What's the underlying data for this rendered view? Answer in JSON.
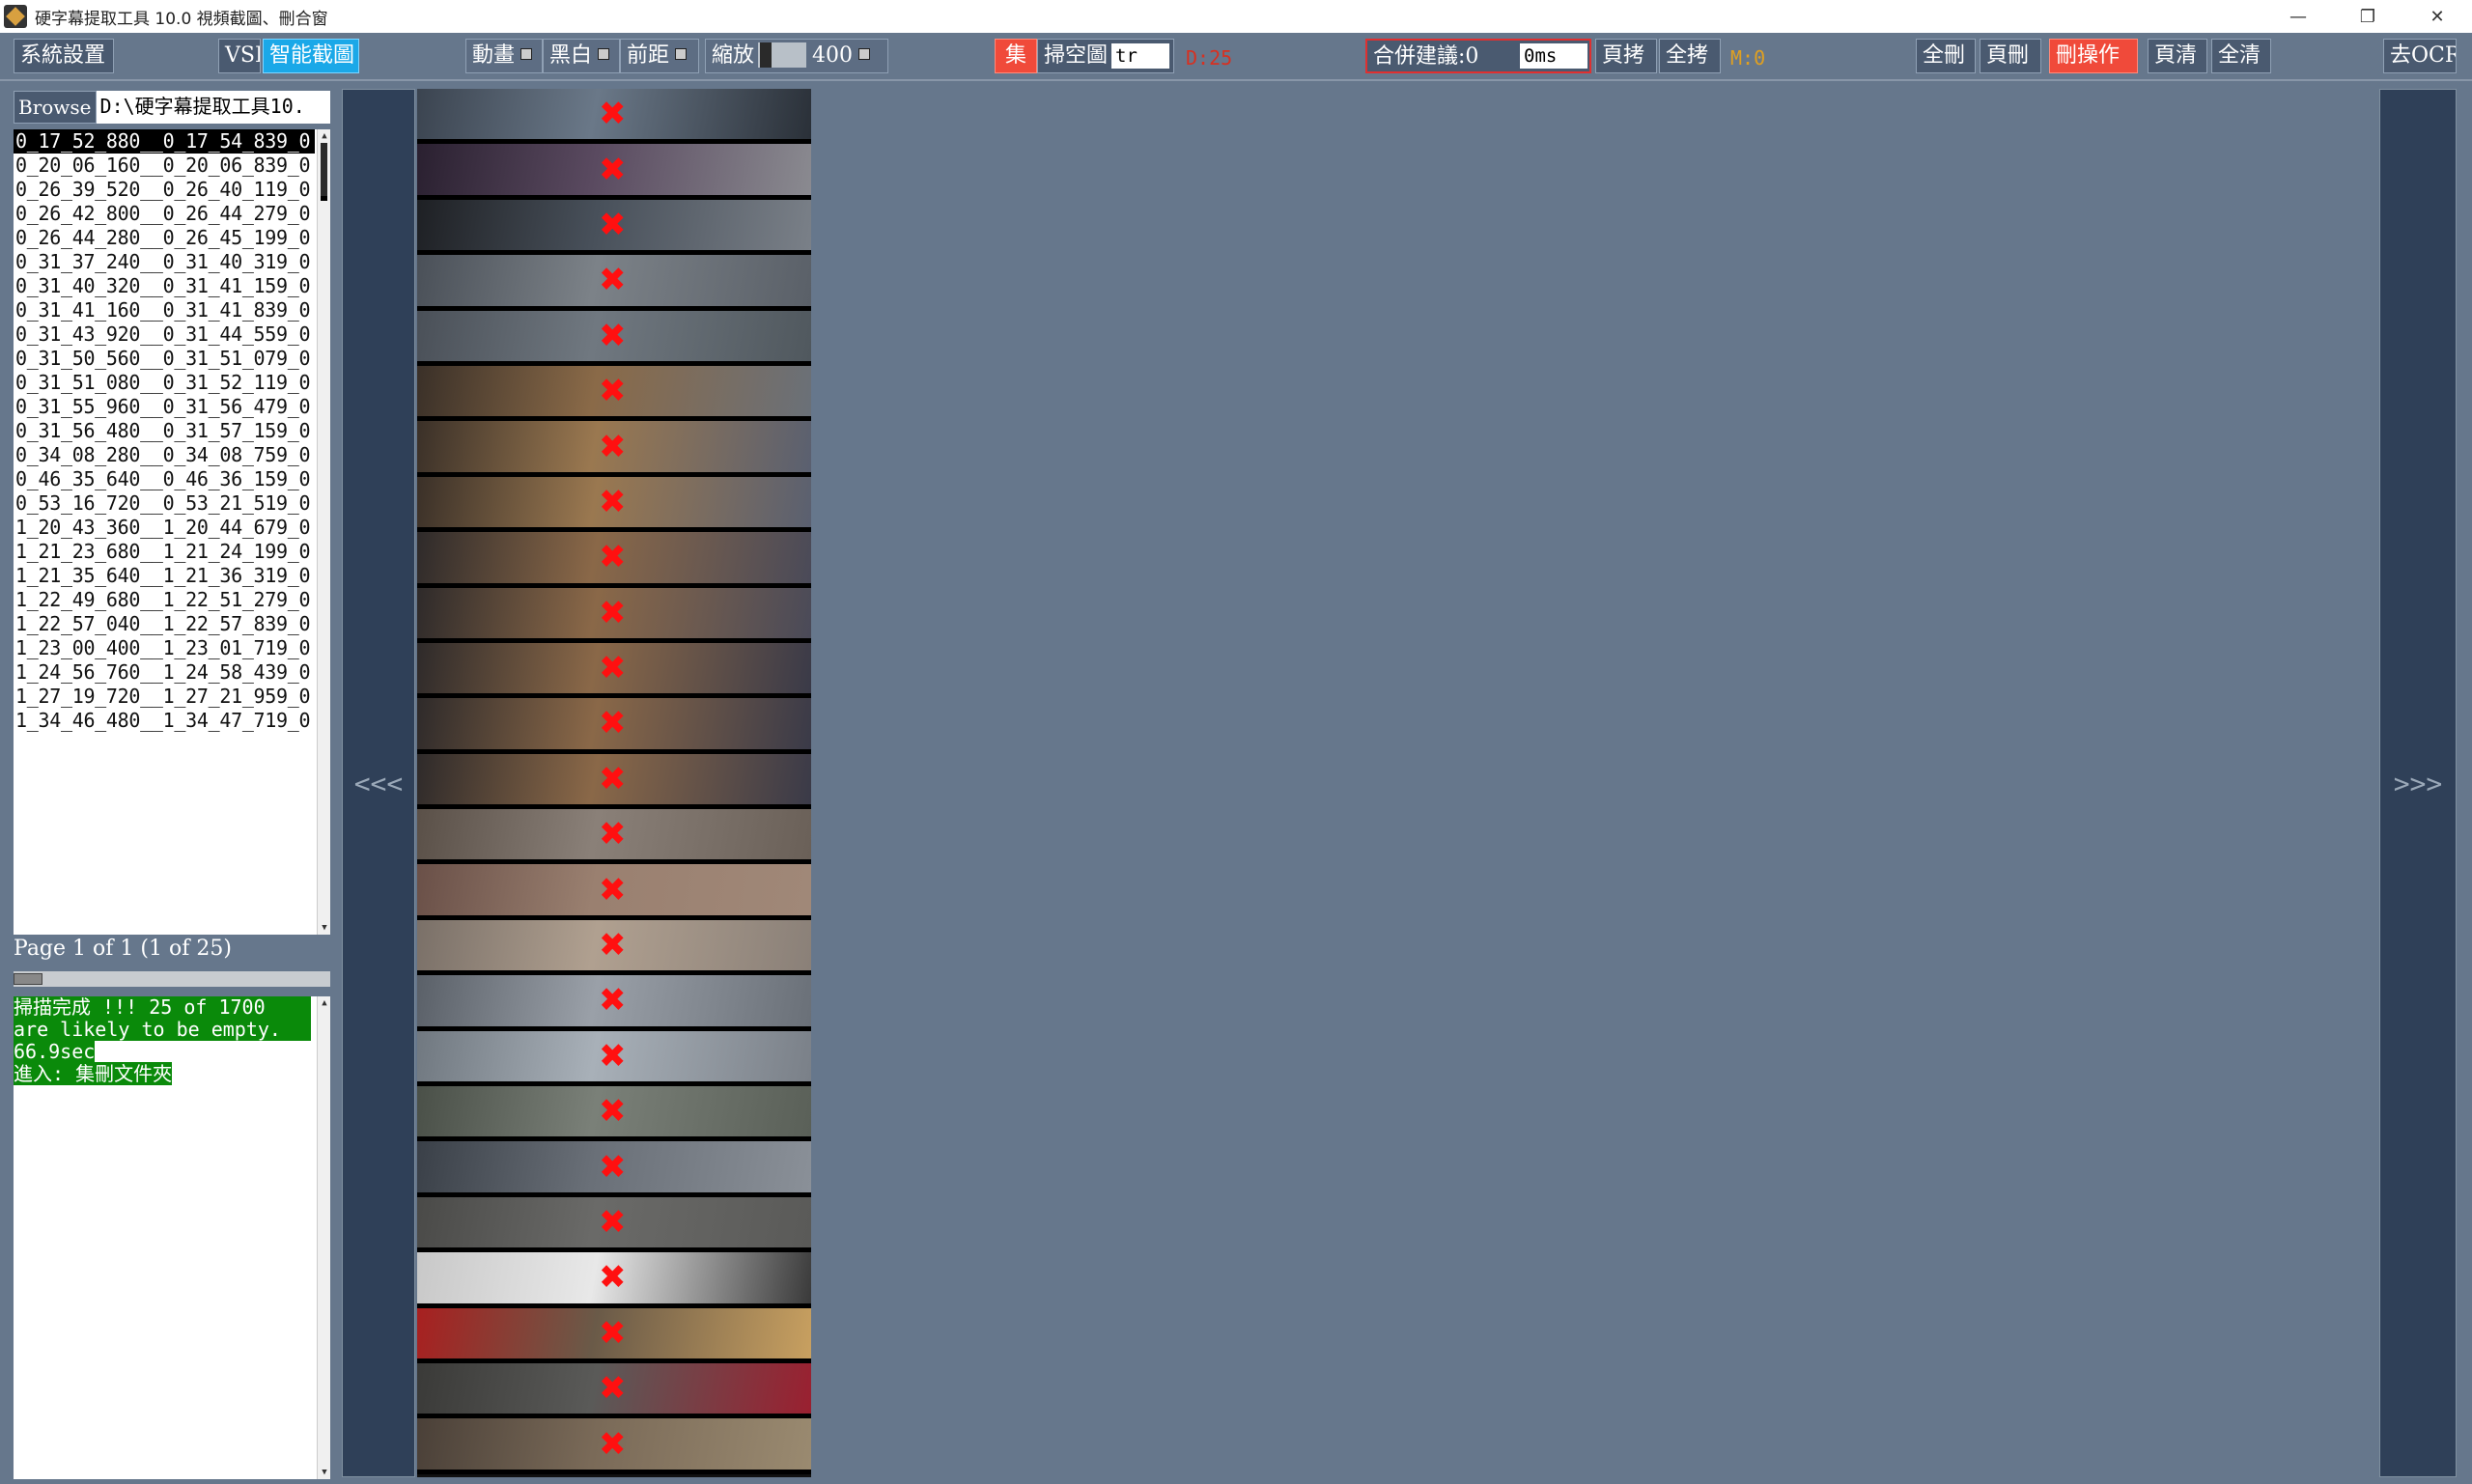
{
  "window": {
    "title": "硬字幕提取工具 10.0  視頻截圖、刪合窗",
    "minimize": "—",
    "maximize": "❐",
    "close": "✕"
  },
  "toolbar": {
    "settings": "系統設置",
    "vsf": "VSF",
    "smart_capture": "智能截圖",
    "animation": "動畫",
    "bw": "黑白",
    "front_margin": "前距",
    "zoom": "縮放",
    "zoom_value": "400",
    "collect": "集",
    "scan_empty": "掃空圖",
    "scan_mode": "tr",
    "d_count": "D:25",
    "merge_suggest": "合併建議:0",
    "merge_ms": "0ms",
    "page_copy": "頁拷",
    "all_copy": "全拷",
    "m_count": "M:0",
    "all_delete": "全刪",
    "page_delete": "頁刪",
    "delete_op": "刪操作",
    "page_clear": "頁清",
    "all_clear": "全清",
    "to_ocr": "去OCR"
  },
  "browse": {
    "button": "Browse",
    "path": "D:\\硬字幕提取工具10."
  },
  "files": [
    "0_17_52_880__0_17_54_839_0",
    "0_20_06_160__0_20_06_839_0",
    "0_26_39_520__0_26_40_119_0",
    "0_26_42_800__0_26_44_279_0",
    "0_26_44_280__0_26_45_199_0",
    "0_31_37_240__0_31_40_319_0",
    "0_31_40_320__0_31_41_159_0",
    "0_31_41_160__0_31_41_839_0",
    "0_31_43_920__0_31_44_559_0",
    "0_31_50_560__0_31_51_079_0",
    "0_31_51_080__0_31_52_119_0",
    "0_31_55_960__0_31_56_479_0",
    "0_31_56_480__0_31_57_159_0",
    "0_34_08_280__0_34_08_759_0",
    "0_46_35_640__0_46_36_159_0",
    "0_53_16_720__0_53_21_519_0",
    "1_20_43_360__1_20_44_679_0",
    "1_21_23_680__1_21_24_199_0",
    "1_21_35_640__1_21_36_319_0",
    "1_22_49_680__1_22_51_279_0",
    "1_22_57_040__1_22_57_839_0",
    "1_23_00_400__1_23_01_719_0",
    "1_24_56_760__1_24_58_439_0",
    "1_27_19_720__1_27_21_959_0",
    "1_34_46_480__1_34_47_719_0"
  ],
  "page_info": "Page 1 of 1 (1 of 25)",
  "log": {
    "line1": "掃描完成 !!!  25 of 1700",
    "line2": "are likely to be empty.",
    "line3": "66.9sec",
    "line4": "進入: 集刪文件夾"
  },
  "nav": {
    "prev": "<<<",
    "next": ">>>"
  },
  "thumbnails": {
    "delete_mark": "✖",
    "colors": [
      [
        "#3b4450",
        "#6a7888",
        "#2a3038"
      ],
      [
        "#2a2030",
        "#5a4a60",
        "#8a8a90"
      ],
      [
        "#1e2024",
        "#48505a",
        "#7a8088"
      ],
      [
        "#4a5058",
        "#7c8288",
        "#5a6068"
      ],
      [
        "#4a5058",
        "#707880",
        "#50585e"
      ],
      [
        "#3a3028",
        "#8a6a48",
        "#6a7078"
      ],
      [
        "#3a3028",
        "#9a7850",
        "#5a6070"
      ],
      [
        "#3a3028",
        "#9a7850",
        "#5a6070"
      ],
      [
        "#2e2a2a",
        "#8a6848",
        "#4a4a58"
      ],
      [
        "#2e2a2a",
        "#8a6848",
        "#4a4a58"
      ],
      [
        "#2e2a2a",
        "#8a6848",
        "#3a3a48"
      ],
      [
        "#2e2a2a",
        "#8a6848",
        "#3a3a48"
      ],
      [
        "#2e2a2a",
        "#8a6848",
        "#3a3a48"
      ],
      [
        "#5a5048",
        "#8a8078",
        "#6a6058"
      ],
      [
        "#6a5048",
        "#9a8070",
        "#a08878"
      ],
      [
        "#7a7068",
        "#b0a090",
        "#8a8078"
      ],
      [
        "#5a6068",
        "#9aa0a8",
        "#6a7078"
      ],
      [
        "#707880",
        "#a8b0b8",
        "#7a8088"
      ],
      [
        "#4a5048",
        "#7a8078",
        "#5a6058"
      ],
      [
        "#3a4048",
        "#6a7078",
        "#8a9098"
      ],
      [
        "#4a4a48",
        "#6a6a68",
        "#5a5a58"
      ],
      [
        "#c8c8c8",
        "#e8e8e8",
        "#3a3a3a"
      ],
      [
        "#a82020",
        "#6a5a48",
        "#c8a060"
      ],
      [
        "#3a3a38",
        "#5a5a58",
        "#9a2030"
      ],
      [
        "#4a4038",
        "#7a6a58",
        "#9a8a70"
      ]
    ]
  }
}
